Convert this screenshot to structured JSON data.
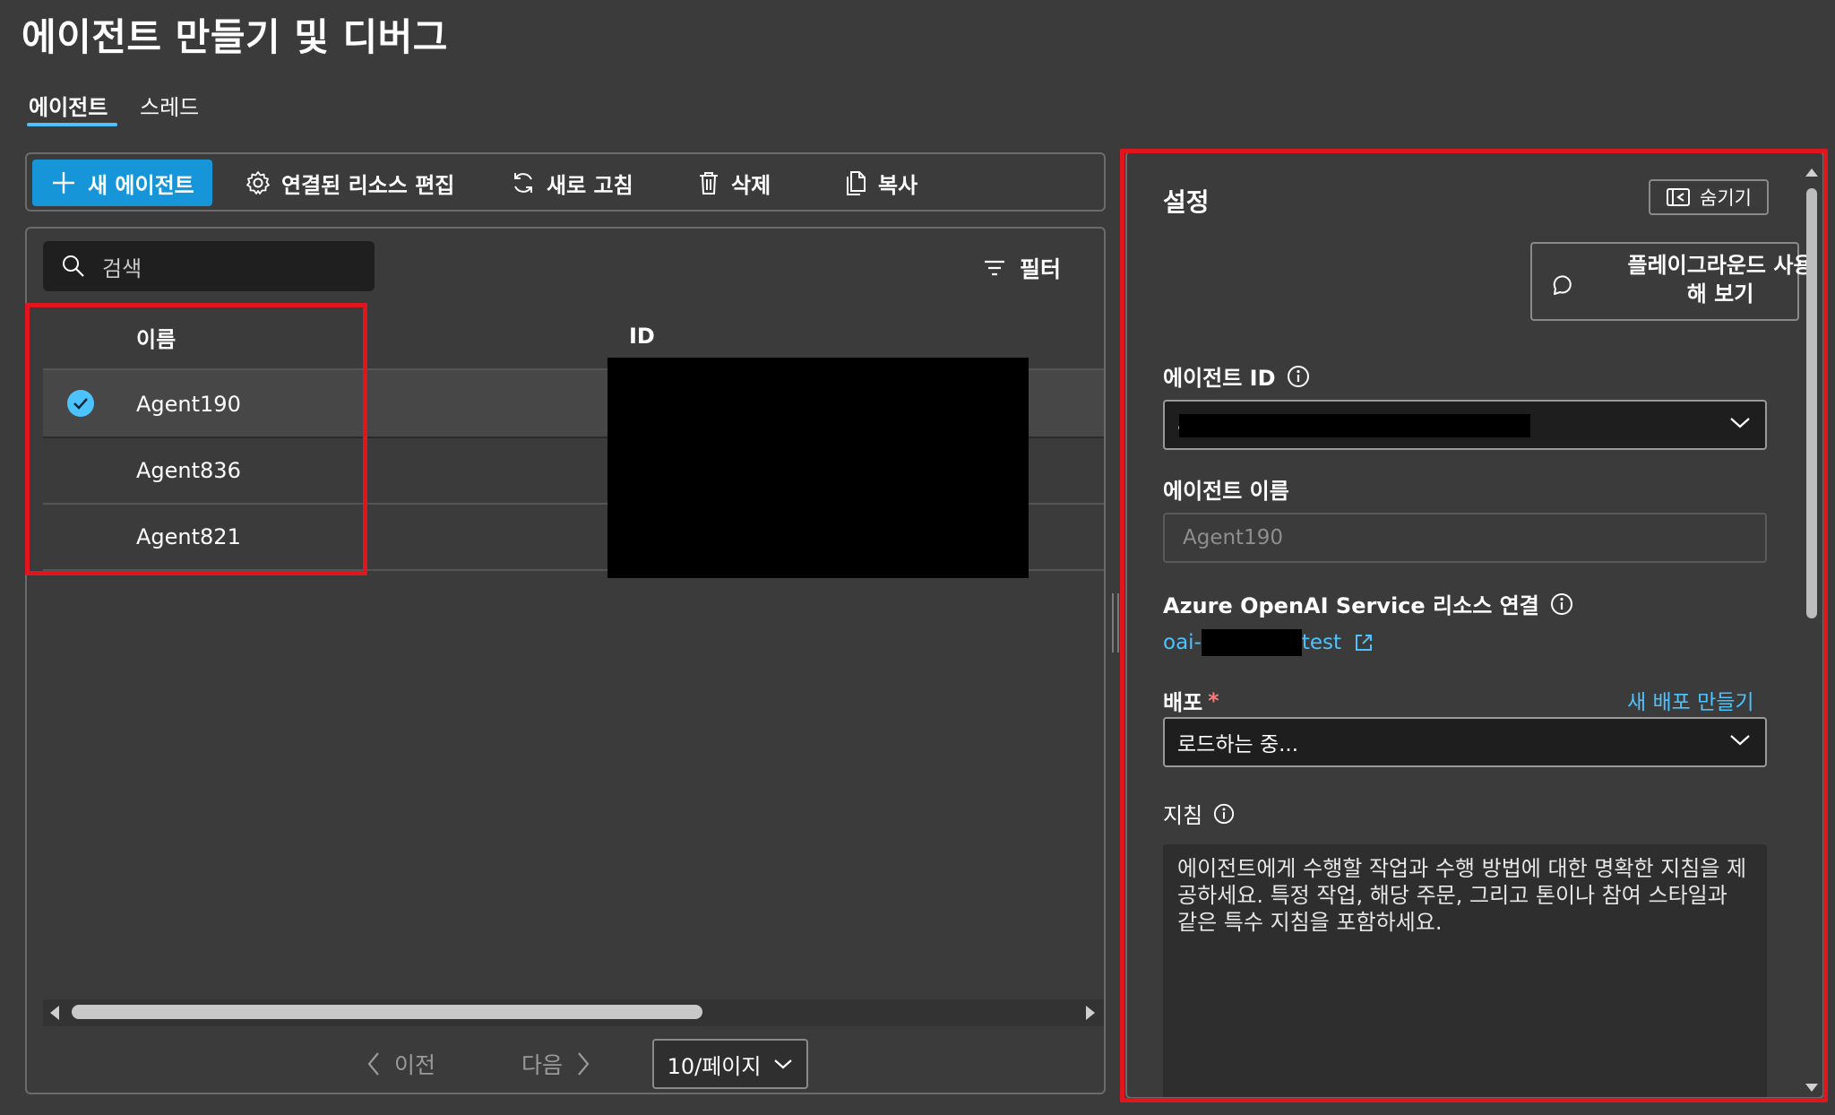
{
  "page": {
    "title": "에이전트 만들기 및 디버그"
  },
  "tabs": [
    {
      "label": "에이전트",
      "active": true
    },
    {
      "label": "스레드",
      "active": false
    }
  ],
  "toolbar": {
    "new_agent": "새 에이전트",
    "edit_resources": "연결된 리소스 편집",
    "refresh": "새로 고침",
    "delete": "삭제",
    "copy": "복사"
  },
  "list": {
    "search_placeholder": "검색",
    "filter_label": "필터",
    "columns": {
      "name": "이름",
      "id": "ID"
    },
    "rows": [
      {
        "name": "Agent190",
        "selected": true
      },
      {
        "name": "Agent836",
        "selected": false
      },
      {
        "name": "Agent821",
        "selected": false
      }
    ],
    "pager": {
      "prev": "이전",
      "next": "다음",
      "page_size": "10/페이지"
    }
  },
  "settings": {
    "title": "설정",
    "hide_label": "숨기기",
    "playground_line1": "플레이그라운드 사용",
    "playground_line2": "해 보기",
    "agent_id_label": "에이전트 ID",
    "agent_id_value": "a",
    "agent_name_label": "에이전트 이름",
    "agent_name_value": "Agent190",
    "resource_label": "Azure OpenAI Service 리소스 연결",
    "resource_link_prefix": "oai-",
    "resource_link_suffix": "test",
    "deployment_label": "배포",
    "deployment_required": "*",
    "new_deployment_link": "새 배포 만들기",
    "deployment_value": "로드하는 중...",
    "instructions_label": "지침",
    "instructions_placeholder": "에이전트에게 수행할 작업과 수행 방법에 대한 명확한 지침을 제공하세요. 특정 작업, 해당 주문, 그리고 톤이나 참여 스타일과 같은 특수 지침을 포함하세요."
  },
  "colors": {
    "accent": "#4cc2ff",
    "primary_button": "#1696d9",
    "highlight": "#e0161f",
    "background": "#3b3b3b"
  },
  "icons": [
    "plus-icon",
    "gear-icon",
    "refresh-icon",
    "trash-icon",
    "copy-icon",
    "search-icon",
    "filter-icon",
    "check-icon",
    "chevron-left-icon",
    "chevron-right-icon",
    "chevron-down-icon",
    "info-icon",
    "external-link-icon",
    "collapse-panel-icon",
    "chat-icon"
  ]
}
